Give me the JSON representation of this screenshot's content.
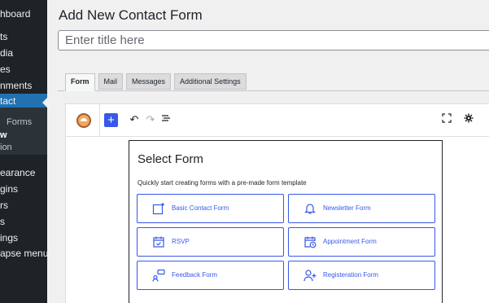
{
  "sidebar": {
    "items": [
      {
        "label": "hboard"
      },
      {
        "label": "ts"
      },
      {
        "label": "dia"
      },
      {
        "label": "es"
      },
      {
        "label": "nments"
      },
      {
        "label": "tact"
      },
      {
        "label": "Forms"
      },
      {
        "label": "w"
      },
      {
        "label": "ion"
      },
      {
        "label": "earance"
      },
      {
        "label": "gins"
      },
      {
        "label": "rs"
      },
      {
        "label": "s"
      },
      {
        "label": "ings"
      },
      {
        "label": "apse menu"
      }
    ]
  },
  "page": {
    "title": "Add New Contact Form",
    "title_placeholder": "Enter title here"
  },
  "tabs": [
    {
      "label": "Form",
      "active": true
    },
    {
      "label": "Mail"
    },
    {
      "label": "Messages"
    },
    {
      "label": "Additional Settings"
    }
  ],
  "toolbar": {
    "icons": [
      "logo-icon",
      "add-block-icon",
      "undo-icon",
      "redo-icon",
      "document-overview-icon",
      "fullscreen-icon",
      "settings-gear-icon"
    ],
    "add_symbol": "+",
    "undo_symbol": "↶",
    "redo_symbol": "↷"
  },
  "select_form": {
    "title": "Select Form",
    "description": "Quickly start creating forms with a pre-made form template",
    "options": [
      {
        "label": "Basic Contact Form",
        "icon": "contact-form-icon"
      },
      {
        "label": "Newsletter Form",
        "icon": "bell-icon"
      },
      {
        "label": "RSVP",
        "icon": "calendar-check-icon"
      },
      {
        "label": "Appointment Form",
        "icon": "calendar-clock-icon"
      },
      {
        "label": "Feedback Form",
        "icon": "feedback-icon"
      },
      {
        "label": "Registeration Form",
        "icon": "user-add-icon"
      }
    ]
  },
  "colors": {
    "sidebar_bg": "#1d2327",
    "accent": "#3858e9",
    "wp_blue": "#2271b1"
  }
}
